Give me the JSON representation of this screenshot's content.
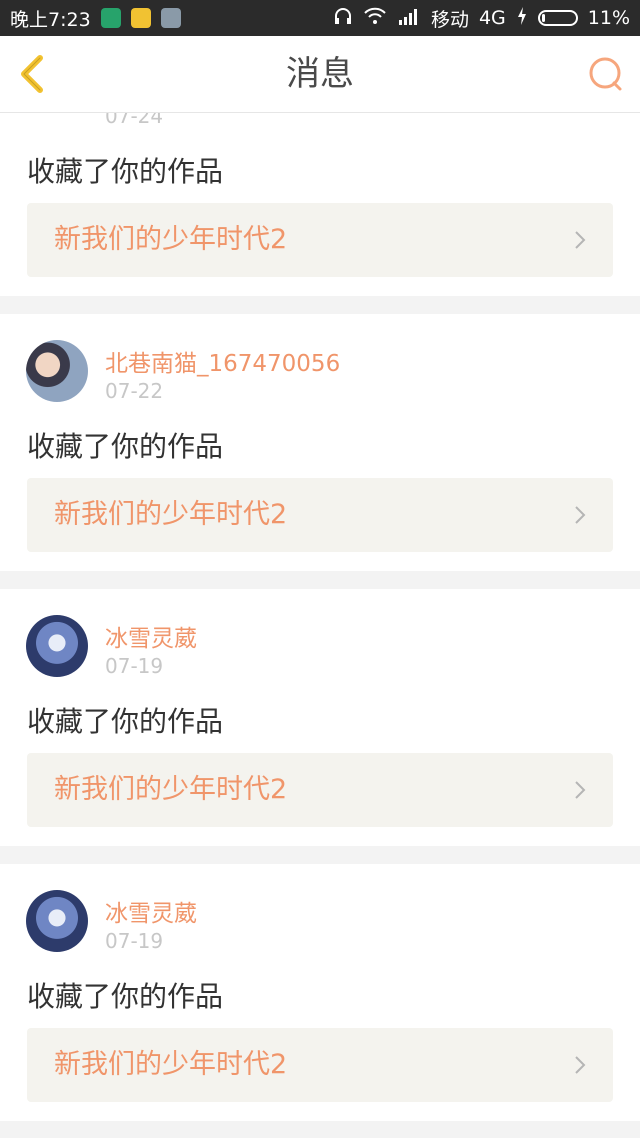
{
  "status_bar": {
    "time": "晚上7:23",
    "carrier": "移动",
    "network": "4G",
    "battery": "11%"
  },
  "header": {
    "title": "消息"
  },
  "notifications": [
    {
      "user": "",
      "date": "07-24",
      "action": "收藏了你的作品",
      "work_title": "新我们的少年时代2"
    },
    {
      "user": "北巷南猫_167470056",
      "date": "07-22",
      "action": "收藏了你的作品",
      "work_title": "新我们的少年时代2"
    },
    {
      "user": "冰雪灵葳",
      "date": "07-19",
      "action": "收藏了你的作品",
      "work_title": "新我们的少年时代2"
    },
    {
      "user": "冰雪灵葳",
      "date": "07-19",
      "action": "收藏了你的作品",
      "work_title": "新我们的少年时代2"
    }
  ],
  "colors": {
    "accent": "#f0956a",
    "back_icon": "#f2c230",
    "search_icon": "#f6a67d"
  }
}
